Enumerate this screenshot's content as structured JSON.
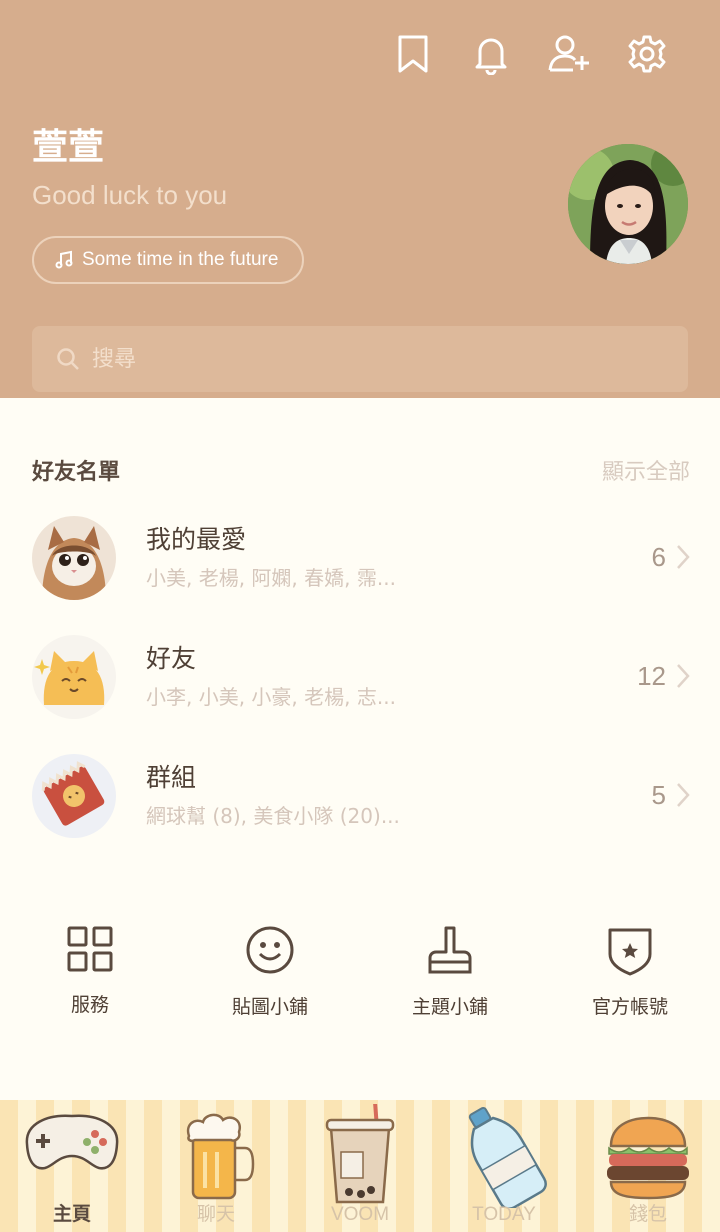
{
  "header": {
    "profile_name": "萱萱",
    "status_message": "Good luck to you",
    "music": "Some time in the future",
    "search_placeholder": "搜尋"
  },
  "friends_section": {
    "title": "好友名單",
    "show_all": "顯示全部",
    "rows": [
      {
        "title": "我的最愛",
        "members": "小美, 老楊, 阿嫻, 春嬌, 霈...",
        "count": "6"
      },
      {
        "title": "好友",
        "members": "小李, 小美, 小豪, 老楊, 志...",
        "count": "12"
      },
      {
        "title": "群組",
        "members": "網球幫 (8), 美食小隊 (20)...",
        "count": "5"
      }
    ]
  },
  "quick_actions": [
    "服務",
    "貼圖小鋪",
    "主題小鋪",
    "官方帳號"
  ],
  "tabs": [
    "主頁",
    "聊天",
    "VOOM",
    "TODAY",
    "錢包"
  ],
  "colors": {
    "header": "#d6ad8d",
    "body": "#fffdf5",
    "text": "#4f4035"
  }
}
